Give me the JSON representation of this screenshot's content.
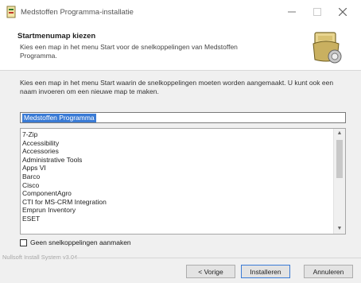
{
  "window": {
    "title": "Medstoffen Programma-installatie"
  },
  "header": {
    "title": "Startmenumap kiezen",
    "subtitle": "Kies een map in het menu Start voor de snelkoppelingen van Medstoffen Programma."
  },
  "body": {
    "intro": "Kies een map in het menu Start waarin de snelkoppelingen moeten worden aangemaakt. U kunt ook een naam invoeren om een nieuwe map te maken.",
    "folder_input": "Medstoffen Programma",
    "list_items": [
      "7-Zip",
      "Accessibility",
      "Accessories",
      "Administrative Tools",
      "Apps VI",
      "Barco",
      "Cisco",
      "ComponentAgro",
      "CTI for MS-CRM Integration",
      "Emprun Inventory",
      "ESET"
    ],
    "no_shortcuts_label": "Geen snelkoppelingen aanmaken"
  },
  "footer": {
    "brand": "Nullsoft Install System v3.04",
    "back_label": "< Vorige",
    "install_label": "Installeren",
    "cancel_label": "Annuleren"
  },
  "colors": {
    "selection": "#3a7bd5",
    "dialog_bg": "#f0f0f0"
  }
}
